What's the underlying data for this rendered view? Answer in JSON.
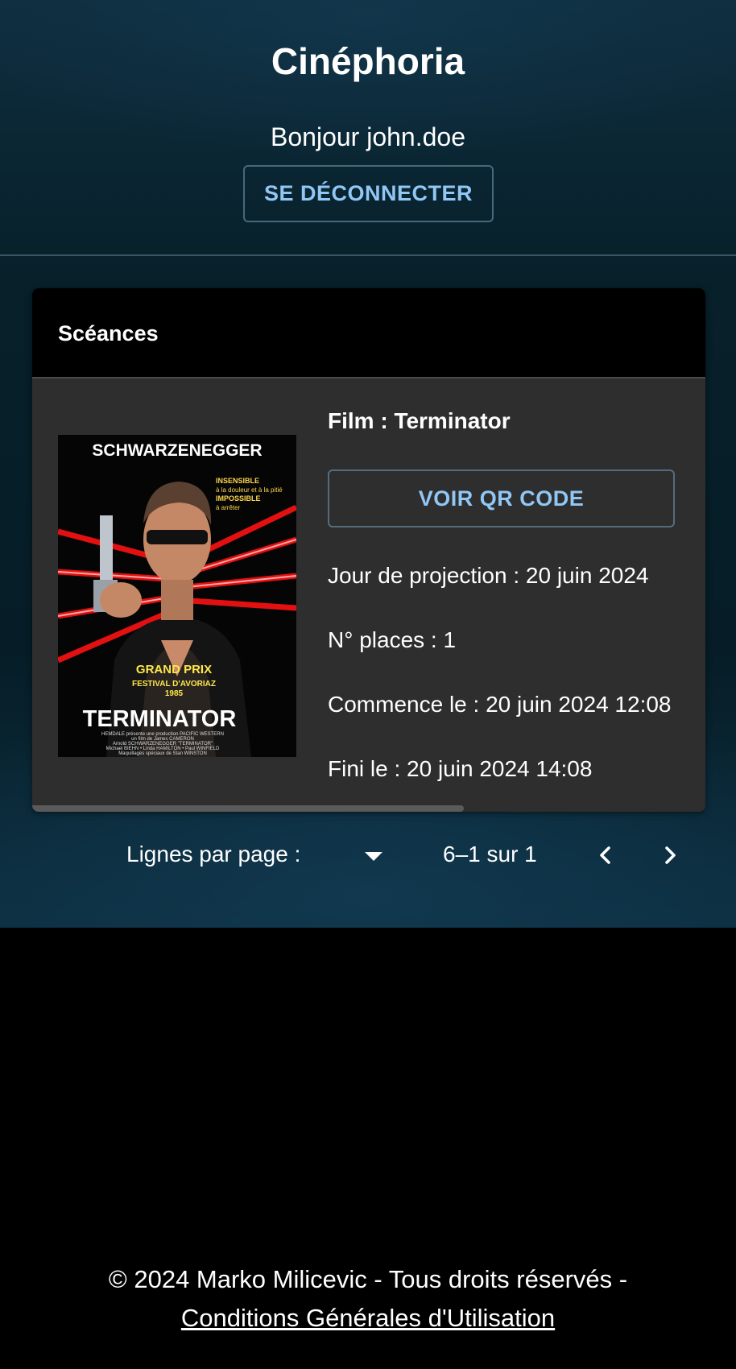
{
  "header": {
    "app_title": "Cinéphoria",
    "greeting": "Bonjour john.doe",
    "logout_label": "SE DÉCONNECTER"
  },
  "sessions_card": {
    "title": "Scéances",
    "item": {
      "poster": {
        "top_text": "SCHWARZENEGGER",
        "tagline": [
          "INSENSIBLE",
          "à la douleur et à la pitié",
          "IMPOSSIBLE",
          "à arrêter"
        ],
        "award": [
          "GRAND PRIX",
          "FESTIVAL D'AVORIAZ",
          "1985"
        ],
        "movie_title": "TERMINATOR",
        "credits": [
          "HEMDALE présente une production PACIFIC WESTERN",
          "un film de James CAMERON",
          "Arnold SCHWARZENEGGER \"TERMINATOR\"",
          "Michael BIEHN • Linda HAMILTON • Paul WINFIELD",
          "Maquillages spéciaux de Stan WINSTON"
        ]
      },
      "film_label": "Film : Terminator",
      "qr_button_label": "VOIR QR CODE",
      "projection_day": "Jour de projection : 20 juin 2024",
      "seats": "N° places : 1",
      "starts": "Commence le : 20 juin 2024 12:08",
      "ends": "Fini le : 20 juin 2024 14:08"
    }
  },
  "pagination": {
    "rows_per_page_label": "Lignes par page :",
    "rows_per_page_value": "",
    "range_text": "6–1 sur 1",
    "prev_icon": "chevron-left-icon",
    "next_icon": "chevron-right-icon"
  },
  "footer": {
    "copyright": "© 2024 Marko Milicevic - Tous droits réservés -",
    "terms_link": "Conditions Générales d'Utilisation"
  },
  "colors": {
    "accent": "#90c7f5",
    "card_bg": "#2e2e2e",
    "card_header_bg": "#000000",
    "hero_bg": "#07202a"
  }
}
